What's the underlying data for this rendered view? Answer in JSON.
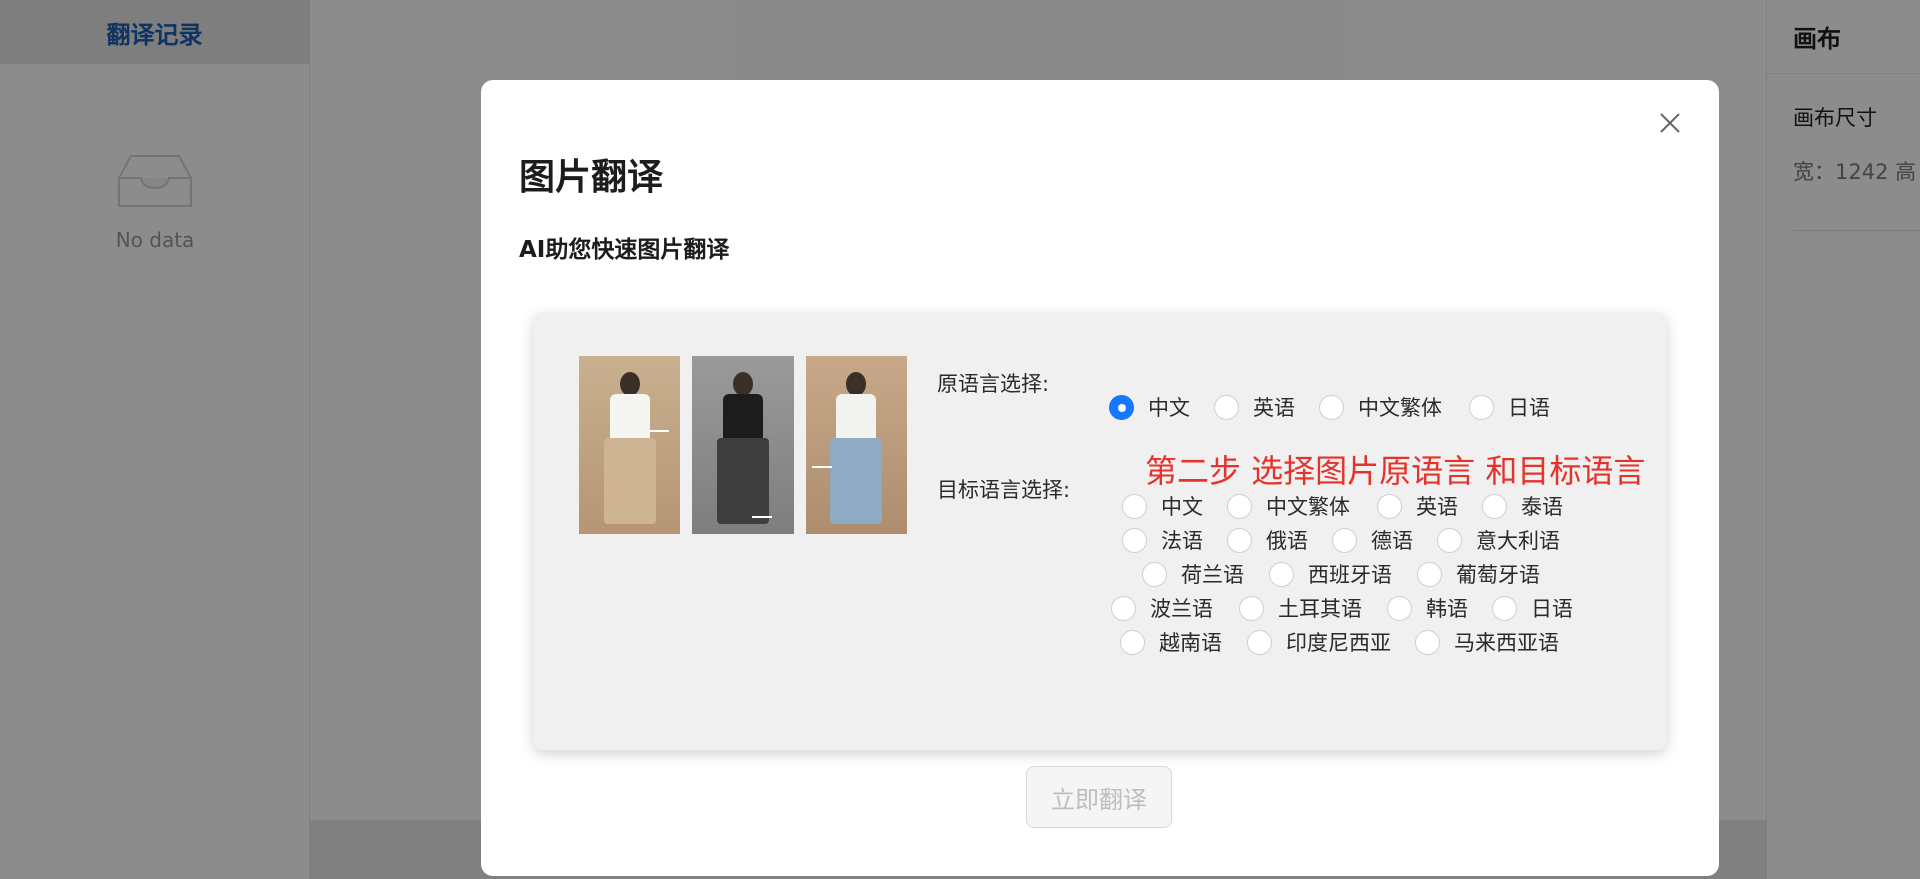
{
  "left_panel": {
    "title": "翻译记录",
    "empty_text": "No data"
  },
  "right_panel": {
    "title": "画布",
    "canvas_size_label": "画布尺寸",
    "dims_text": "宽：1242   高"
  },
  "modal": {
    "title": "图片翻译",
    "subtitle": "AI助您快速图片翻译",
    "source_label": "原语言选择:",
    "target_label": "目标语言选择:",
    "source_options": [
      "中文",
      "英语",
      "中文繁体",
      "日语"
    ],
    "source_selected": "中文",
    "hint": "第二步 选择图片原语言 和目标语言",
    "target_options": [
      "中文",
      "中文繁体",
      "英语",
      "泰语",
      "法语",
      "俄语",
      "德语",
      "意大利语",
      "荷兰语",
      "西班牙语",
      "葡萄牙语",
      "波兰语",
      "土耳其语",
      "韩语",
      "日语",
      "越南语",
      "印度尼西亚",
      "马来西亚语"
    ],
    "translate_button": "立即翻译"
  },
  "colors": {
    "accent": "#1677ff",
    "hint": "#e5322a",
    "left_title": "#1a5fb4"
  }
}
